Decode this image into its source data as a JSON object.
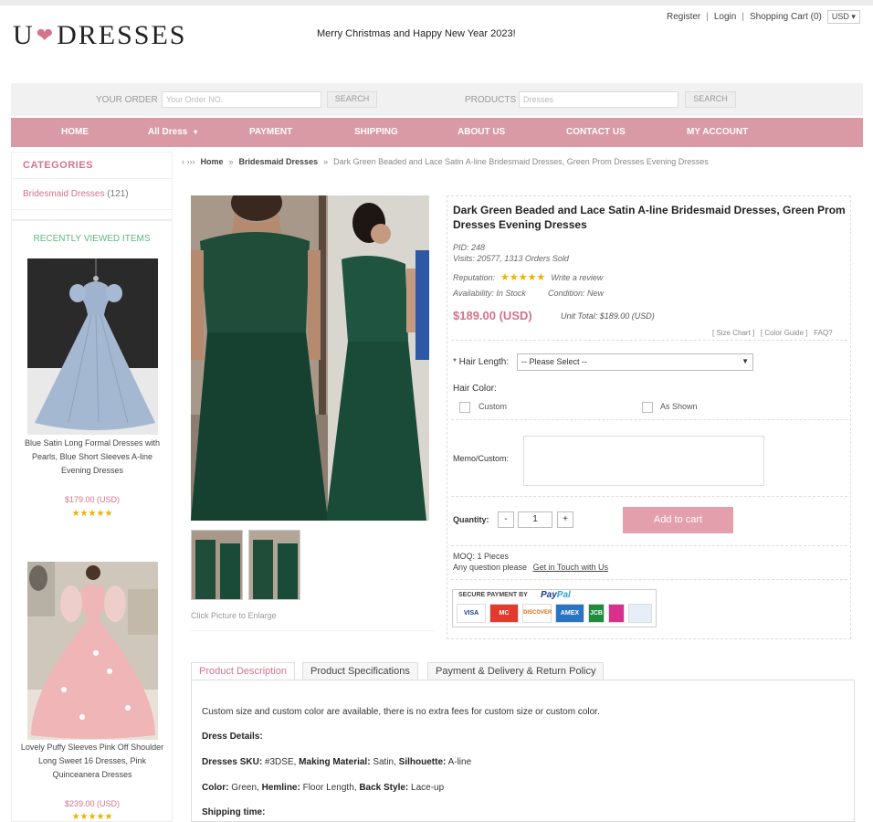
{
  "header": {
    "logo_left": "U",
    "logo_right": "DRESSES",
    "greeting": "Merry Christmas and Happy New Year 2023!",
    "links": [
      "Register",
      "Login",
      "Shopping Cart (0)"
    ],
    "currency": "USD ▾"
  },
  "search": {
    "order_label": "YOUR ORDER",
    "order_placeholder": "Your Order NO.",
    "order_button": "SEARCH",
    "products_label": "PRODUCTS",
    "products_placeholder": "Dresses",
    "products_button": "SEARCH"
  },
  "nav": {
    "items": [
      "HOME",
      "All Dress",
      "PAYMENT",
      "SHIPPING",
      "ABOUT US",
      "CONTACT US",
      "MY ACCOUNT"
    ],
    "dropdown_caret": "▾"
  },
  "sidebar": {
    "categories_title": "CATEGORIES",
    "category": {
      "name": "Bridesmaid Dresses",
      "count": "(121)"
    },
    "recent_title": "RECENTLY VIEWED ITEMS",
    "items": [
      {
        "name": "Blue Satin Long Formal Dresses with Pearls, Blue Short Sleeves A-line Evening Dresses",
        "price": "$179.00 (USD)",
        "stars": "★★★★★"
      },
      {
        "name": "Lovely Puffy Sleeves Pink Off Shoulder Long Sweet 16 Dresses, Pink Quinceanera Dresses",
        "price": "$239.00 (USD)",
        "stars": "★★★★★"
      }
    ]
  },
  "breadcrumb": {
    "arrows": "› ››› ",
    "home": "Home",
    "sep": "»",
    "category": "Bridesmaid Dresses",
    "current": "Dark Green Beaded and Lace Satin A-line Bridesmaid Dresses, Green Prom Dresses Evening Dresses"
  },
  "gallery": {
    "enlarge": "Click Picture to Enlarge"
  },
  "product": {
    "title": "Dark Green Beaded and Lace Satin A-line Bridesmaid Dresses, Green Prom Dresses Evening Dresses",
    "pid": "PID: 248",
    "visits": "Visits: 20577, 1313 Orders Sold",
    "reputation_label": "Reputation:",
    "stars": "★★★★★",
    "write_review": "Write a review",
    "availability": "Availability: In Stock",
    "condition": "Condition: New",
    "price": "$189.00 (USD)",
    "unit_total": "Unit Total: $189.00 (USD)",
    "size_chart": "[ Size Chart ]",
    "color_guide": "[ Color Guide ]",
    "faq": "FAQ?",
    "hair_length_label": "* Hair Length:",
    "hair_length_value": "-- Please Select --",
    "hair_color_label": "Hair Color:",
    "hair_color_options": [
      "Custom",
      "As Shown"
    ],
    "memo_label": "Memo/Custom:",
    "quantity_label": "Quantity:",
    "qty_minus": "-",
    "qty_value": "1",
    "qty_plus": "+",
    "add_to_cart": "Add to cart",
    "moq": "MOQ: 1 Pieces",
    "question": "Any question please",
    "contact_link": "Get in Touch with Us",
    "secure_payment": "SECURE PAYMENT BY",
    "paypal_pay": "Pay",
    "paypal_pal": "Pal",
    "cards": [
      "VISA",
      "MC",
      "DISCOVER",
      "AMEX",
      "JCB",
      "",
      ""
    ]
  },
  "tabs": {
    "items": [
      "Product Description",
      "Product Specifications",
      "Payment & Delivery & Return Policy"
    ],
    "intro": "Custom size and custom color are available, there is no extra fees for custom size or custom color.",
    "details_title": "Dress Details:",
    "sku_label": "Dresses SKU:",
    "sku_value": " #3DSE,",
    "material_label": " Making Material:",
    "material_value": " Satin,",
    "silhouette_label": " Silhouette:",
    "silhouette_value": " A-line",
    "color_label": "Color:",
    "color_value": " Green,",
    "hemline_label": " Hemline:",
    "hemline_value": " Floor Length,",
    "back_label": " Back Style:",
    "back_value": " Lace-up",
    "shipping_title": "Shipping time:"
  },
  "colors": {
    "accent_pink": "#d99aa5",
    "price_pink": "#d2738a",
    "dress_green": "#1d4a35",
    "recent_green": "#5cb87d"
  }
}
